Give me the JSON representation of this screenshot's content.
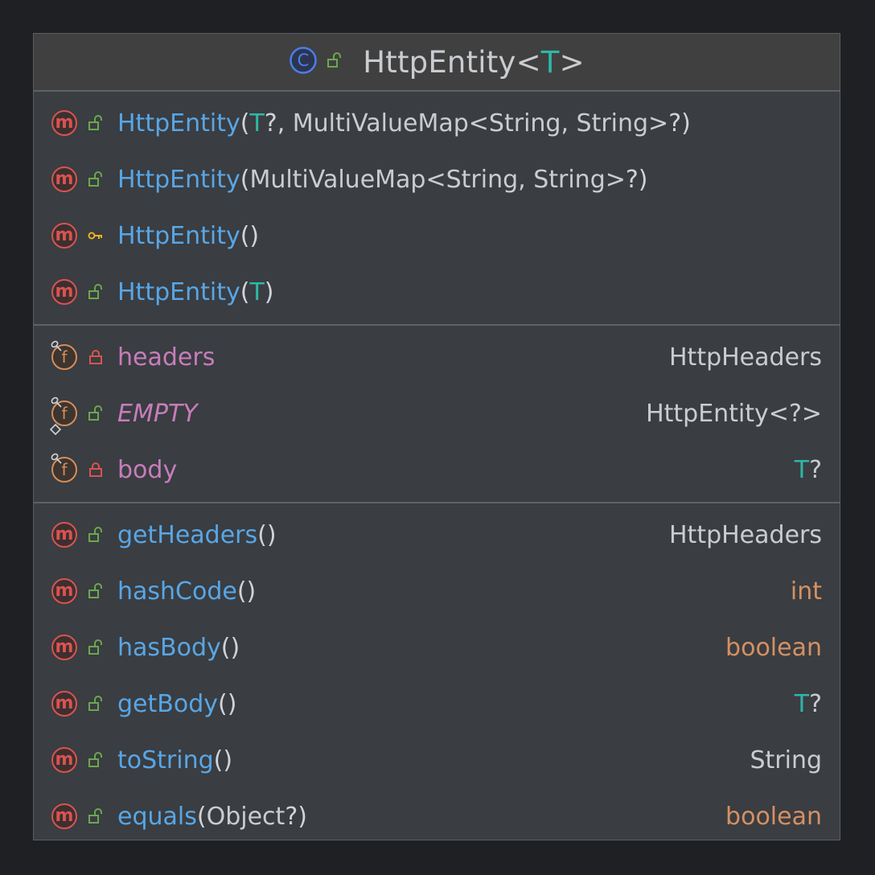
{
  "class": {
    "kind_icon": "class-icon",
    "visibility_icon": "public-unlock-icon",
    "name": "HttpEntity",
    "type_param_open": "<",
    "type_param": "T",
    "type_param_close": ">"
  },
  "constructors": [
    {
      "icon": "method-icon",
      "visibility": "public",
      "name": "HttpEntity",
      "params": [
        {
          "text": "(",
          "cls": "paren"
        },
        {
          "text": "T",
          "cls": "tp"
        },
        {
          "text": "?, ",
          "cls": "paren"
        },
        {
          "text": "MultiValueMap<String, String>",
          "cls": "paramtxt"
        },
        {
          "text": "?)",
          "cls": "paren"
        }
      ]
    },
    {
      "icon": "method-icon",
      "visibility": "public",
      "name": "HttpEntity",
      "params": [
        {
          "text": "(",
          "cls": "paren"
        },
        {
          "text": "MultiValueMap<String, String>",
          "cls": "paramtxt"
        },
        {
          "text": "?)",
          "cls": "paren"
        }
      ]
    },
    {
      "icon": "method-icon",
      "visibility": "protected",
      "name": "HttpEntity",
      "params": [
        {
          "text": "()",
          "cls": "paren"
        }
      ]
    },
    {
      "icon": "method-icon",
      "visibility": "public",
      "name": "HttpEntity",
      "params": [
        {
          "text": "(",
          "cls": "paren"
        },
        {
          "text": "T",
          "cls": "tp"
        },
        {
          "text": ")",
          "cls": "paren"
        }
      ]
    }
  ],
  "fields": [
    {
      "icon": "field-icon",
      "final": true,
      "static": false,
      "visibility": "private",
      "name": "headers",
      "italic": false,
      "type": [
        {
          "text": "HttpHeaders",
          "cls": ""
        }
      ]
    },
    {
      "icon": "field-icon",
      "final": true,
      "static": true,
      "visibility": "public",
      "name": "EMPTY",
      "italic": true,
      "type": [
        {
          "text": "HttpEntity<?>",
          "cls": ""
        }
      ]
    },
    {
      "icon": "field-icon",
      "final": true,
      "static": false,
      "visibility": "private",
      "name": "body",
      "italic": false,
      "type": [
        {
          "text": "T",
          "cls": "tp"
        },
        {
          "text": "?",
          "cls": ""
        }
      ]
    }
  ],
  "methods": [
    {
      "icon": "method-icon",
      "visibility": "public",
      "name": "getHeaders",
      "params": [
        {
          "text": "()",
          "cls": "paren"
        }
      ],
      "type": [
        {
          "text": "HttpHeaders",
          "cls": ""
        }
      ],
      "kw": false
    },
    {
      "icon": "method-icon",
      "visibility": "public",
      "name": "hashCode",
      "params": [
        {
          "text": "()",
          "cls": "paren"
        }
      ],
      "type": [
        {
          "text": "int",
          "cls": ""
        }
      ],
      "kw": true
    },
    {
      "icon": "method-icon",
      "visibility": "public",
      "name": "hasBody",
      "params": [
        {
          "text": "()",
          "cls": "paren"
        }
      ],
      "type": [
        {
          "text": "boolean",
          "cls": ""
        }
      ],
      "kw": true
    },
    {
      "icon": "method-icon",
      "visibility": "public",
      "name": "getBody",
      "params": [
        {
          "text": "()",
          "cls": "paren"
        }
      ],
      "type": [
        {
          "text": "T",
          "cls": "tp"
        },
        {
          "text": "?",
          "cls": ""
        }
      ],
      "kw": false
    },
    {
      "icon": "method-icon",
      "visibility": "public",
      "name": "toString",
      "params": [
        {
          "text": "()",
          "cls": "paren"
        }
      ],
      "type": [
        {
          "text": "String",
          "cls": ""
        }
      ],
      "kw": false
    },
    {
      "icon": "method-icon",
      "visibility": "public",
      "name": "equals",
      "params": [
        {
          "text": "(",
          "cls": "paren"
        },
        {
          "text": "Object",
          "cls": "paramtxt"
        },
        {
          "text": "?)",
          "cls": "paren"
        }
      ],
      "type": [
        {
          "text": "boolean",
          "cls": ""
        }
      ],
      "kw": true
    }
  ],
  "colors": {
    "background": "#1f2024",
    "card": "#3a3d41",
    "header": "#404040",
    "method_name": "#58a6e6",
    "field_name": "#c77dbb",
    "type_param": "#2fb7a6",
    "keyword_type": "#d59063",
    "method_icon": "#d8544f",
    "field_icon": "#d58d5a",
    "public_vis": "#6aa84f",
    "private_vis": "#d8544f",
    "protected_vis": "#e6b422"
  }
}
